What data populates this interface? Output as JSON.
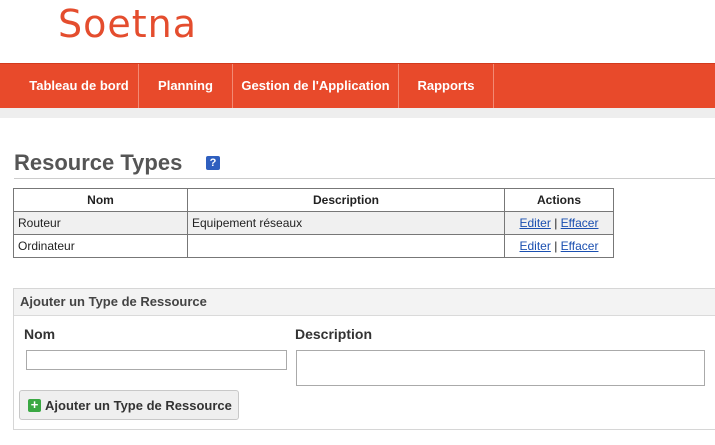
{
  "logo": "Soetna",
  "nav": [
    {
      "label": "Tableau de bord"
    },
    {
      "label": "Planning"
    },
    {
      "label": "Gestion de l'Application"
    },
    {
      "label": "Rapports"
    }
  ],
  "page": {
    "title": "Resource Types",
    "help_icon": "?"
  },
  "table": {
    "headers": [
      "Nom",
      "Description",
      "Actions"
    ],
    "rows": [
      {
        "nom": "Routeur",
        "description": "Equipement réseaux",
        "edit": "Editer",
        "sep": "|",
        "delete": "Effacer"
      },
      {
        "nom": "Ordinateur",
        "description": "",
        "edit": "Editer",
        "sep": "|",
        "delete": "Effacer"
      }
    ]
  },
  "form": {
    "header": "Ajouter un Type de Ressource",
    "nom_label": "Nom",
    "nom_value": "",
    "description_label": "Description",
    "description_value": "",
    "submit_label": "Ajouter un Type de Ressource",
    "submit_icon": "+"
  },
  "colors": {
    "brand": "#e84a2b",
    "link": "#1a4fb0"
  }
}
